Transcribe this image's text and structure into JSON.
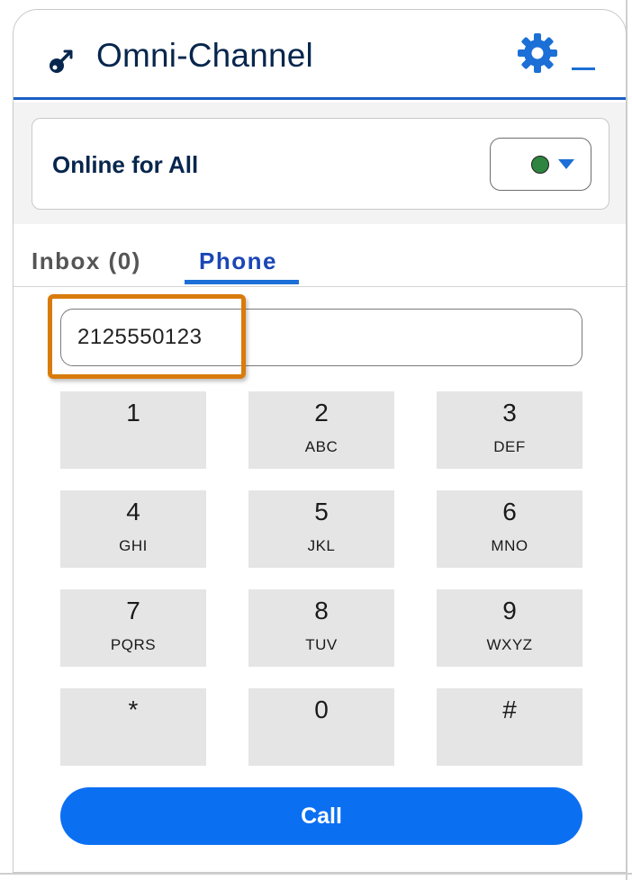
{
  "header": {
    "title": "Omni-Channel",
    "app_icon": "omni-channel-icon",
    "settings_icon": "gear-icon",
    "minimize_label": "_"
  },
  "status": {
    "label": "Online for All",
    "indicator_color": "#2e8540",
    "dropdown_icon": "caret-down-icon"
  },
  "tabs": [
    {
      "label": "Inbox (0)",
      "active": false
    },
    {
      "label": "Phone",
      "active": true
    }
  ],
  "dialer": {
    "number_value": "2125550123",
    "keys": [
      {
        "digit": "1",
        "letters": ""
      },
      {
        "digit": "2",
        "letters": "ABC"
      },
      {
        "digit": "3",
        "letters": "DEF"
      },
      {
        "digit": "4",
        "letters": "GHI"
      },
      {
        "digit": "5",
        "letters": "JKL"
      },
      {
        "digit": "6",
        "letters": "MNO"
      },
      {
        "digit": "7",
        "letters": "PQRS"
      },
      {
        "digit": "8",
        "letters": "TUV"
      },
      {
        "digit": "9",
        "letters": "WXYZ"
      },
      {
        "digit": "*",
        "letters": ""
      },
      {
        "digit": "0",
        "letters": ""
      },
      {
        "digit": "#",
        "letters": ""
      }
    ],
    "call_label": "Call"
  },
  "colors": {
    "accent": "#1b6fd6",
    "call_button": "#0b6ff2",
    "highlight": "#d97b0c",
    "title_text": "#07264d"
  }
}
